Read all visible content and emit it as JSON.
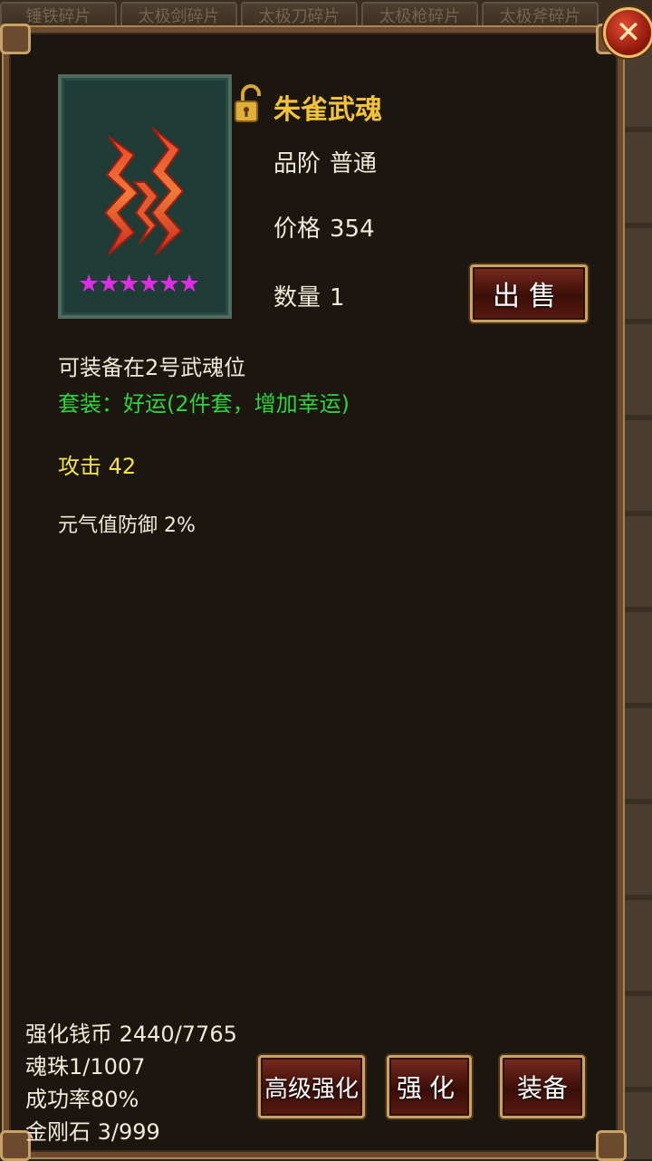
{
  "background_tabs": [
    "锤铁碎片",
    "太极剑碎片",
    "太极刀碎片",
    "太极枪碎片",
    "太极斧碎片"
  ],
  "close_button": {
    "label": "✕"
  },
  "item": {
    "name": "朱雀武魂",
    "stars": "★★★★★★",
    "star_count": 6,
    "quality_label": "品阶",
    "quality_value": "普通",
    "price_label": "价格",
    "price_value": "354",
    "quantity_label": "数量",
    "quantity_value": "1"
  },
  "sell_button": {
    "label": "出售"
  },
  "details": {
    "equip_slot": "可装备在2号武魂位",
    "set_info": "套装：好运(2件套，增加幸运)",
    "attack": "攻击  42",
    "defense": "元气值防御  2%"
  },
  "stats": {
    "coin": "强化钱币 2440/7765",
    "soul_bead": "魂珠1/1007",
    "success_rate": "成功率80%",
    "diamond": "金刚石 3/999"
  },
  "buttons": {
    "advanced_enhance": "高级强化",
    "enhance": "强化",
    "equip": "装备"
  },
  "colors": {
    "item_name": "#f2c23a",
    "set_info": "#2fd43a",
    "attack": "#f3e24a",
    "stars": "#e22be8"
  }
}
